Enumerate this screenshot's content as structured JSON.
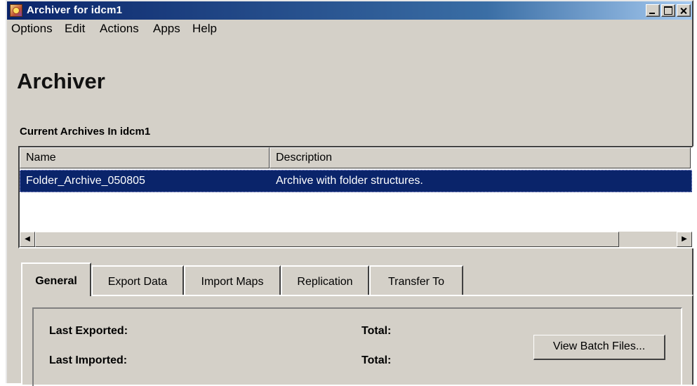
{
  "window": {
    "title": "Archiver for idcm1"
  },
  "menu": [
    "Options",
    "Edit",
    "Actions",
    "Apps",
    "Help"
  ],
  "heading": "Archiver",
  "archives_section": {
    "label": "Current Archives In idcm1",
    "columns": [
      "Name",
      "Description"
    ],
    "rows": [
      {
        "name": "Folder_Archive_050805",
        "description": "Archive with folder structures.",
        "selected": true
      }
    ]
  },
  "tabs": [
    "General",
    "Export Data",
    "Import Maps",
    "Replication",
    "Transfer To"
  ],
  "active_tab": "General",
  "general": {
    "last_exported_label": "Last Exported:",
    "last_imported_label": "Last Imported:",
    "total_label_1": "Total:",
    "total_label_2": "Total:",
    "view_batch_files_button": "View Batch Files..."
  },
  "colors": {
    "titlebar": "#0a246a",
    "selection": "#0a246a",
    "window_bg": "#d4d0c8"
  },
  "icons": [
    "app-icon",
    "minimize-icon",
    "maximize-icon",
    "close-icon",
    "scroll-left-arrow-icon",
    "scroll-right-arrow-icon"
  ]
}
